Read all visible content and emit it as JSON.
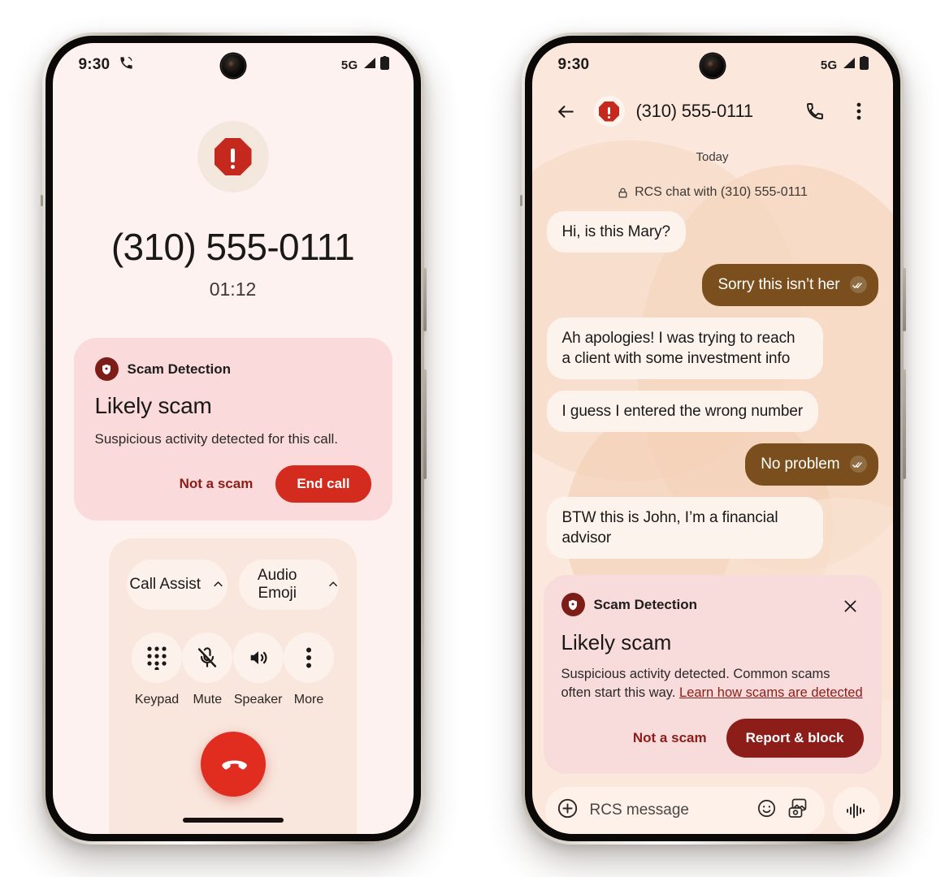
{
  "call_phone": {
    "status_bar": {
      "time": "9:30",
      "call_icon": "phone-in-call-icon",
      "network": "5G"
    },
    "caller": {
      "number": "(310) 555-0111",
      "duration": "01:12",
      "avatar_icon": "scam-octagon-warning-icon"
    },
    "scam_card": {
      "badge_icon": "shield-check-icon",
      "label": "Scam Detection",
      "title": "Likely scam",
      "description": "Suspicious activity detected for this call.",
      "secondary_action": "Not a scam",
      "primary_action": "End call"
    },
    "assist_chips": [
      {
        "label": "Call Assist",
        "icon": "chevron-up-icon"
      },
      {
        "label": "Audio Emoji",
        "icon": "chevron-up-icon"
      }
    ],
    "controls": [
      {
        "label": "Keypad",
        "icon": "dialpad-icon"
      },
      {
        "label": "Mute",
        "icon": "mic-off-icon"
      },
      {
        "label": "Speaker",
        "icon": "speaker-icon"
      },
      {
        "label": "More",
        "icon": "more-vertical-icon"
      }
    ],
    "end_call_button": {
      "icon": "call-end-icon"
    }
  },
  "message_phone": {
    "status_bar": {
      "time": "9:30",
      "network": "5G"
    },
    "app_bar": {
      "back_icon": "arrow-left-icon",
      "contact_icon": "scam-octagon-warning-icon",
      "title": "(310) 555-0111",
      "call_icon": "phone-icon",
      "overflow_icon": "more-vertical-icon"
    },
    "thread": {
      "day_label": "Today",
      "rcs_note": "RCS chat with (310) 555-0111",
      "rcs_note_icon": "lock-icon",
      "messages": [
        {
          "side": "in",
          "text": "Hi, is this Mary?"
        },
        {
          "side": "out",
          "text": "Sorry this isn’t her",
          "receipt": "read-receipt-icon"
        },
        {
          "side": "in",
          "text": "Ah apologies! I was trying to reach a client with some investment info"
        },
        {
          "side": "in",
          "text": "I guess I entered the wrong number"
        },
        {
          "side": "out",
          "text": "No problem",
          "receipt": "read-receipt-icon"
        },
        {
          "side": "in",
          "text": "BTW this is John, I’m a financial advisor"
        }
      ]
    },
    "scam_card": {
      "badge_icon": "shield-check-icon",
      "label": "Scam Detection",
      "close_icon": "close-icon",
      "title": "Likely scam",
      "description": "Suspicious activity detected. Common scams often start this way. ",
      "link_text": "Learn how scams are detected",
      "secondary_action": "Not a scam",
      "primary_action": "Report & block"
    },
    "composer": {
      "add_icon": "plus-circle-icon",
      "placeholder": "RCS message",
      "emoji_icon": "emoji-smile-icon",
      "gallery_icon": "image-gallery-icon",
      "voice_icon": "voice-waveform-icon"
    }
  },
  "colors": {
    "call_bg": "#fdf2ef",
    "msg_bg": "#fbe7dc",
    "scam_card_call": "#fadada",
    "scam_card_msg": "#f8dbdb",
    "danger_red": "#d32b1e",
    "danger_dark": "#8c1d18",
    "bubble_out": "#7a4f1d",
    "bubble_in": "#fdf3ed"
  }
}
